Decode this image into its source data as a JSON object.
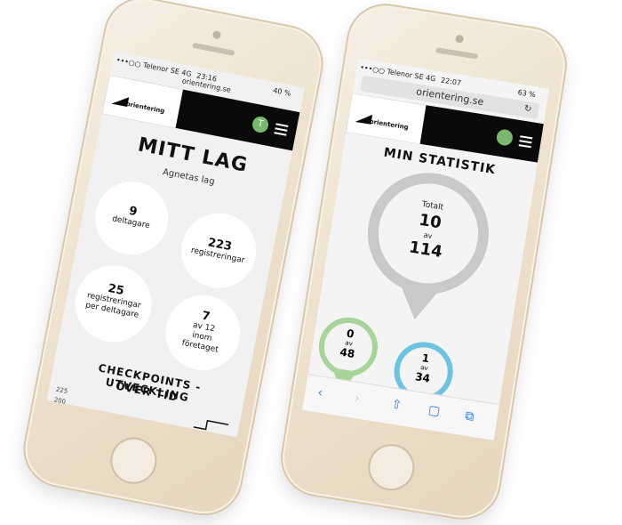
{
  "left_phone": {
    "status": {
      "carrier": "•••○○ Telenor SE  4G",
      "time": "23:16",
      "battery": "40 %"
    },
    "url": "orientering.se",
    "logo_text": "orientering",
    "avatar_letter": "T",
    "title": "MITT LAG",
    "subtitle": "Agnetas lag",
    "stats": [
      {
        "num": "9",
        "label": "deltagare"
      },
      {
        "num": "223",
        "label": "registreringar"
      },
      {
        "num": "25",
        "label": "registreringar per deltagare"
      },
      {
        "num": "7",
        "label": "av 12 inom företaget"
      }
    ],
    "section_title_1": "CHECKPOINTS - UTVECKLING",
    "section_title_2": "ÖVER TID",
    "axis_labels": [
      "225",
      "200"
    ]
  },
  "right_phone": {
    "status": {
      "carrier": "•••○○ Telenor SE  4G",
      "time": "22:07",
      "battery": "63 %"
    },
    "url": "orientering.se",
    "reload_icon": "↻",
    "logo_text": "orientering",
    "avatar_letter": "",
    "title": "MIN STATISTIK",
    "main_pin": {
      "top": "Totalt",
      "num": "10",
      "of": "av",
      "total": "114",
      "color": "#c9c9c9"
    },
    "pins": [
      {
        "num": "0",
        "of": "av",
        "total": "48",
        "color": "#a8d49a"
      },
      {
        "num": "1",
        "of": "av",
        "total": "34",
        "color": "#6cc4e0"
      }
    ],
    "toolbar_icons": [
      "back-icon",
      "forward-icon",
      "share-icon",
      "bookmarks-icon",
      "tabs-icon"
    ],
    "toolbar_glyphs": [
      "‹",
      "›",
      "⇧",
      "▢",
      "⧉"
    ]
  },
  "colors": {
    "header": "#0a0a0a",
    "accent_green": "#78b96e",
    "ios_blue": "#2f7cf6"
  }
}
